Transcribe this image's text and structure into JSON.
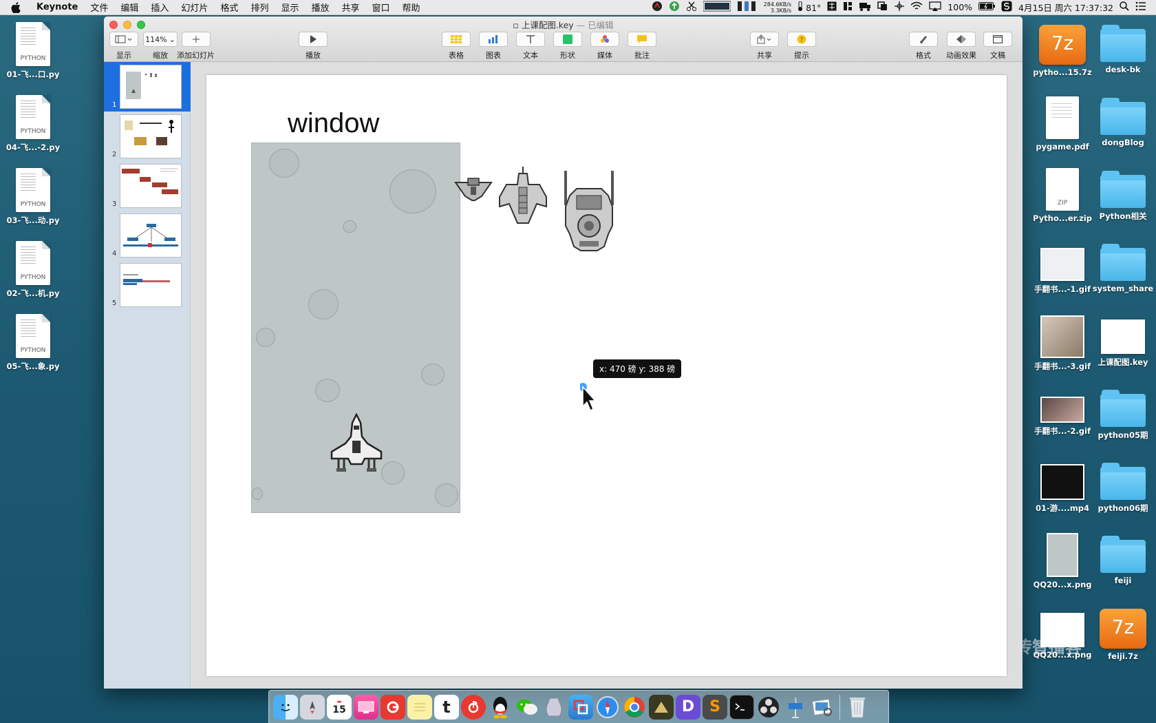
{
  "menubar": {
    "app_name": "Keynote",
    "menus": [
      "文件",
      "编辑",
      "插入",
      "幻灯片",
      "格式",
      "排列",
      "显示",
      "播放",
      "共享",
      "窗口",
      "帮助"
    ],
    "net_up": "284.6KB/s",
    "net_down": "3.3KB/s",
    "temperature": "81°",
    "battery": "100%",
    "datetime": "4月15日 周六  17:37:32"
  },
  "window": {
    "title": "上课配图.key",
    "edited": "— 已编辑",
    "toolbar": {
      "view": "显示",
      "zoom_value": "114%",
      "zoom": "缩放",
      "add_slide": "添加幻灯片",
      "play": "播放",
      "table": "表格",
      "chart": "图表",
      "text": "文本",
      "shape": "形状",
      "media": "媒体",
      "comment": "批注",
      "share": "共享",
      "tips": "提示",
      "format": "格式",
      "animate": "动画效果",
      "document": "文稿"
    }
  },
  "navigator": {
    "slides": [
      {
        "num": "1",
        "selected": true
      },
      {
        "num": "2",
        "selected": false
      },
      {
        "num": "3",
        "selected": false
      },
      {
        "num": "4",
        "selected": false
      },
      {
        "num": "5",
        "selected": false
      }
    ]
  },
  "slide": {
    "title": "window"
  },
  "tooltip": {
    "text": "x: 470 磅  y: 388 磅"
  },
  "desktop_left": [
    {
      "name": "01-飞...口.py",
      "tag": "PYTHON"
    },
    {
      "name": "04-飞...-2.py",
      "tag": "PYTHON"
    },
    {
      "name": "03-飞...动.py",
      "tag": "PYTHON"
    },
    {
      "name": "02-飞...机.py",
      "tag": "PYTHON"
    },
    {
      "name": "05-飞...象.py",
      "tag": "PYTHON"
    }
  ],
  "desktop_right": [
    {
      "name": "pytho...15.7z",
      "kind": "7z"
    },
    {
      "name": "desk-bk",
      "kind": "folder"
    },
    {
      "name": "pygame.pdf",
      "kind": "doc"
    },
    {
      "name": "dongBlog",
      "kind": "folder"
    },
    {
      "name": "Pytho...er.zip",
      "kind": "zip",
      "tag": "ZIP"
    },
    {
      "name": "Python相关",
      "kind": "folder"
    },
    {
      "name": "手翻书...-1.gif",
      "kind": "thumb"
    },
    {
      "name": "system_share",
      "kind": "folder"
    },
    {
      "name": "手翻书...-3.gif",
      "kind": "thumb"
    },
    {
      "name": "上课配图.key",
      "kind": "thumb"
    },
    {
      "name": "手翻书...-2.gif",
      "kind": "thumb"
    },
    {
      "name": "python05期",
      "kind": "folder"
    },
    {
      "name": "01-游....mp4",
      "kind": "thumb"
    },
    {
      "name": "python06期",
      "kind": "folder"
    },
    {
      "name": "QQ20...x.png",
      "kind": "thumb"
    },
    {
      "name": "feiji",
      "kind": "folder"
    },
    {
      "name": "QQ20...x.png",
      "kind": "thumb"
    },
    {
      "name": "feiji.7z",
      "kind": "7z"
    }
  ],
  "icons": {
    "seven_zip": "7z",
    "dock_calendar": "15",
    "dock_t": "t",
    "dock_s": "S",
    "dock_d": "D"
  },
  "watermark": "传智播客"
}
